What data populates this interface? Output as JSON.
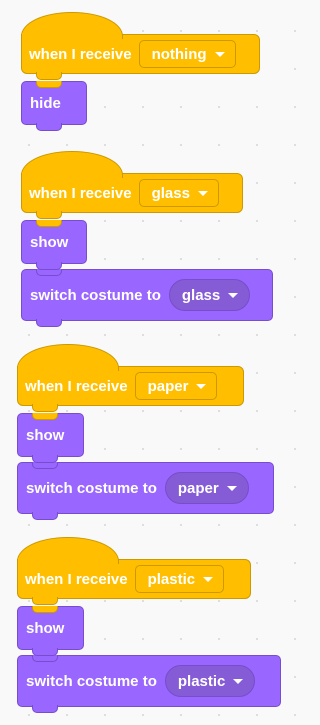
{
  "scripts": [
    {
      "hat_label": "when I receive",
      "message": "nothing",
      "blocks": [
        {
          "type": "show_hide",
          "label": "hide"
        }
      ]
    },
    {
      "hat_label": "when I receive",
      "message": "glass",
      "blocks": [
        {
          "type": "show_hide",
          "label": "show"
        },
        {
          "type": "switch_costume",
          "label": "switch costume to",
          "costume": "glass"
        }
      ]
    },
    {
      "hat_label": "when I receive",
      "message": "paper",
      "blocks": [
        {
          "type": "show_hide",
          "label": "show"
        },
        {
          "type": "switch_costume",
          "label": "switch costume to",
          "costume": "paper"
        }
      ]
    },
    {
      "hat_label": "when I receive",
      "message": "plastic",
      "blocks": [
        {
          "type": "show_hide",
          "label": "show"
        },
        {
          "type": "switch_costume",
          "label": "switch costume to",
          "costume": "plastic"
        }
      ]
    }
  ],
  "colors": {
    "events": "#ffbf00",
    "events_border": "#cc9900",
    "looks": "#9966ff",
    "looks_border": "#774dcb",
    "looks_menu": "#855cd6",
    "workspace": "#f9f9f9"
  },
  "icons": {
    "dropdown": "caret-down-icon"
  }
}
